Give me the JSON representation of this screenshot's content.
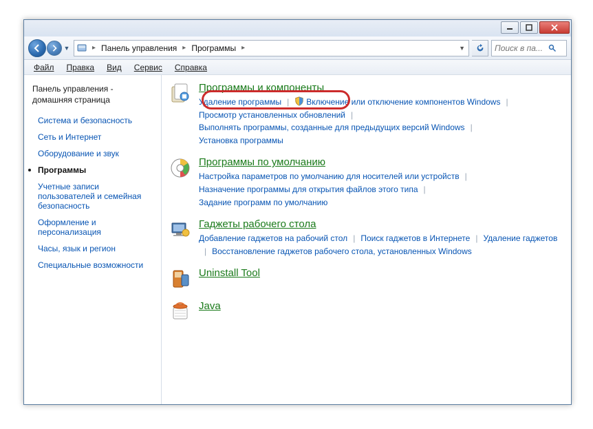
{
  "breadcrumbs": {
    "root": "Панель управления",
    "current": "Программы"
  },
  "search": {
    "placeholder": "Поиск в па..."
  },
  "menu": {
    "file": "Файл",
    "edit": "Правка",
    "view": "Вид",
    "tools": "Сервис",
    "help": "Справка"
  },
  "sidebar": {
    "home1": "Панель управления -",
    "home2": "домашняя страница",
    "items": [
      "Система и безопасность",
      "Сеть и Интернет",
      "Оборудование и звук",
      "Программы",
      "Учетные записи пользователей и семейная безопасность",
      "Оформление и персонализация",
      "Часы, язык и регион",
      "Специальные возможности"
    ],
    "active_index": 3
  },
  "categories": [
    {
      "title": "Программы и компоненты",
      "links": [
        {
          "t": "Удаление программы"
        },
        {
          "t": "Включение или отключение компонентов Windows",
          "shield": true
        },
        {
          "t": "Просмотр установленных обновлений"
        },
        {
          "t": "Выполнять программы, созданные для предыдущих версий Windows"
        },
        {
          "t": "Установка программы"
        }
      ]
    },
    {
      "title": "Программы по умолчанию",
      "links": [
        {
          "t": "Настройка параметров по умолчанию для носителей или устройств"
        },
        {
          "t": "Назначение программы для открытия файлов этого типа"
        },
        {
          "t": "Задание программ по умолчанию"
        }
      ]
    },
    {
      "title": "Гаджеты рабочего стола",
      "links": [
        {
          "t": "Добавление гаджетов на рабочий стол"
        },
        {
          "t": "Поиск гаджетов в Интернете"
        },
        {
          "t": "Удаление гаджетов"
        },
        {
          "t": "Восстановление гаджетов рабочего стола, установленных Windows"
        }
      ]
    },
    {
      "title": "Uninstall Tool",
      "links": []
    },
    {
      "title": "Java",
      "links": []
    }
  ]
}
